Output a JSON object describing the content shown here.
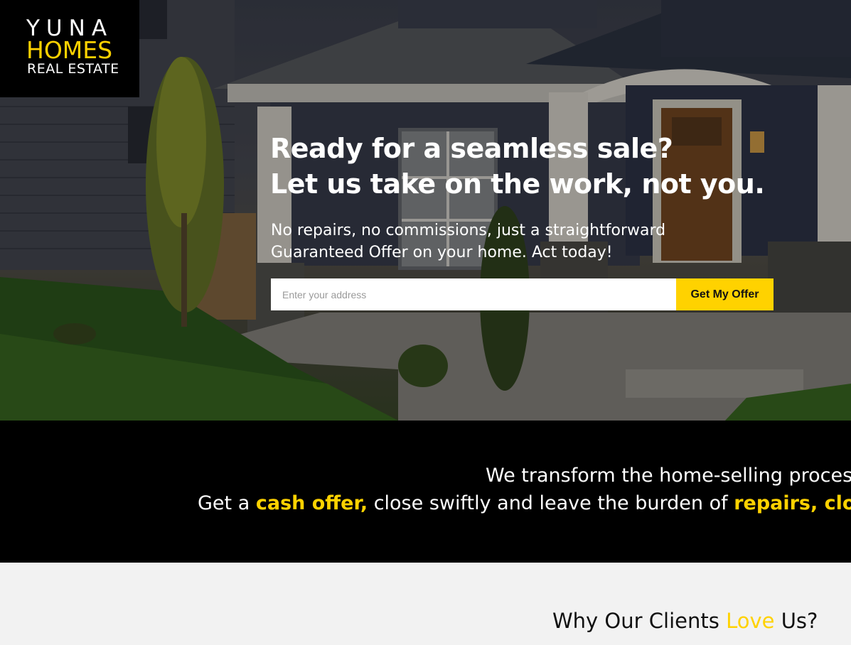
{
  "logo": {
    "line1": "YUNA",
    "line2": "HOMES",
    "line3": "REAL ESTATE"
  },
  "hero": {
    "title_line1": "Ready for a seamless sale?",
    "title_line2": "Let us take on the work, not you.",
    "subtitle_line1": "No repairs, no commissions, just a straightforward",
    "subtitle_line2": "Guaranteed Offer on your home. Act today!",
    "address_placeholder": "Enter your address",
    "button_label": "Get My Offer"
  },
  "band": {
    "line1": "We transform the home-selling proces",
    "line2_part1": "Get a ",
    "line2_accent1": "cash offer,",
    "line2_part2": " close swiftly and leave the burden of ",
    "line2_accent2": "repairs, closin"
  },
  "clients": {
    "title_part1": "Why Our Clients ",
    "title_accent": "Love",
    "title_part2": " Us?"
  },
  "colors": {
    "accent": "#ffd200",
    "band_bg": "#000000",
    "section_bg": "#f2f2f2"
  }
}
